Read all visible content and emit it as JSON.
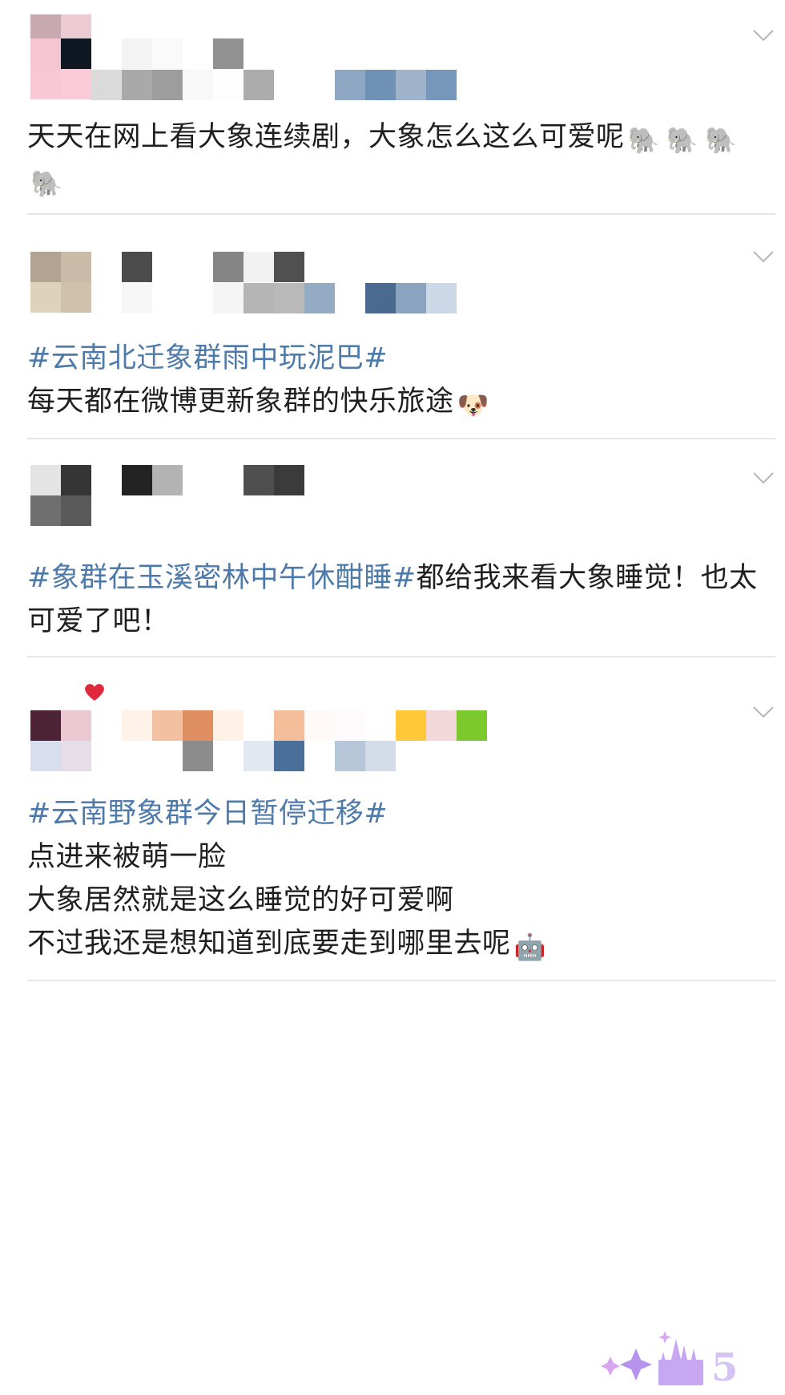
{
  "posts": [
    {
      "text": "天天在网上看大象连续剧，大象怎么这么可爱呢",
      "trailing_emoji": [
        "🐘",
        "🐘",
        "🐘",
        "🐘"
      ]
    },
    {
      "hashtag": "#云南北迁象群雨中玩泥巴#",
      "text": "每天都在微博更新象群的快乐旅途",
      "trailing_emoji": [
        "🐶"
      ]
    },
    {
      "hashtag": "#象群在玉溪密林中午休酣睡#",
      "text": "都给我来看大象睡觉！也太可爱了吧！"
    },
    {
      "hashtag": "#云南野象群今日暂停迁移#",
      "lines": [
        "点进来被萌一脸",
        "大象居然就是这么睡觉的好可爱啊",
        "不过我还是想知道到底要走到哪里去呢"
      ],
      "trailing_emoji": [
        "🤖"
      ]
    }
  ],
  "icons": {
    "more": "chevron-down-icon",
    "elephant": "elephant-emoji",
    "husky": "husky-emoji",
    "doraemon": "doraemon-emoji",
    "heart": "heart-icon",
    "castle": "castle-badge-icon"
  },
  "colors": {
    "hashtag": "#4d7aa8",
    "text": "#1f1f1f",
    "divider": "#e6e6e6",
    "chevron": "#b5b5b5"
  }
}
